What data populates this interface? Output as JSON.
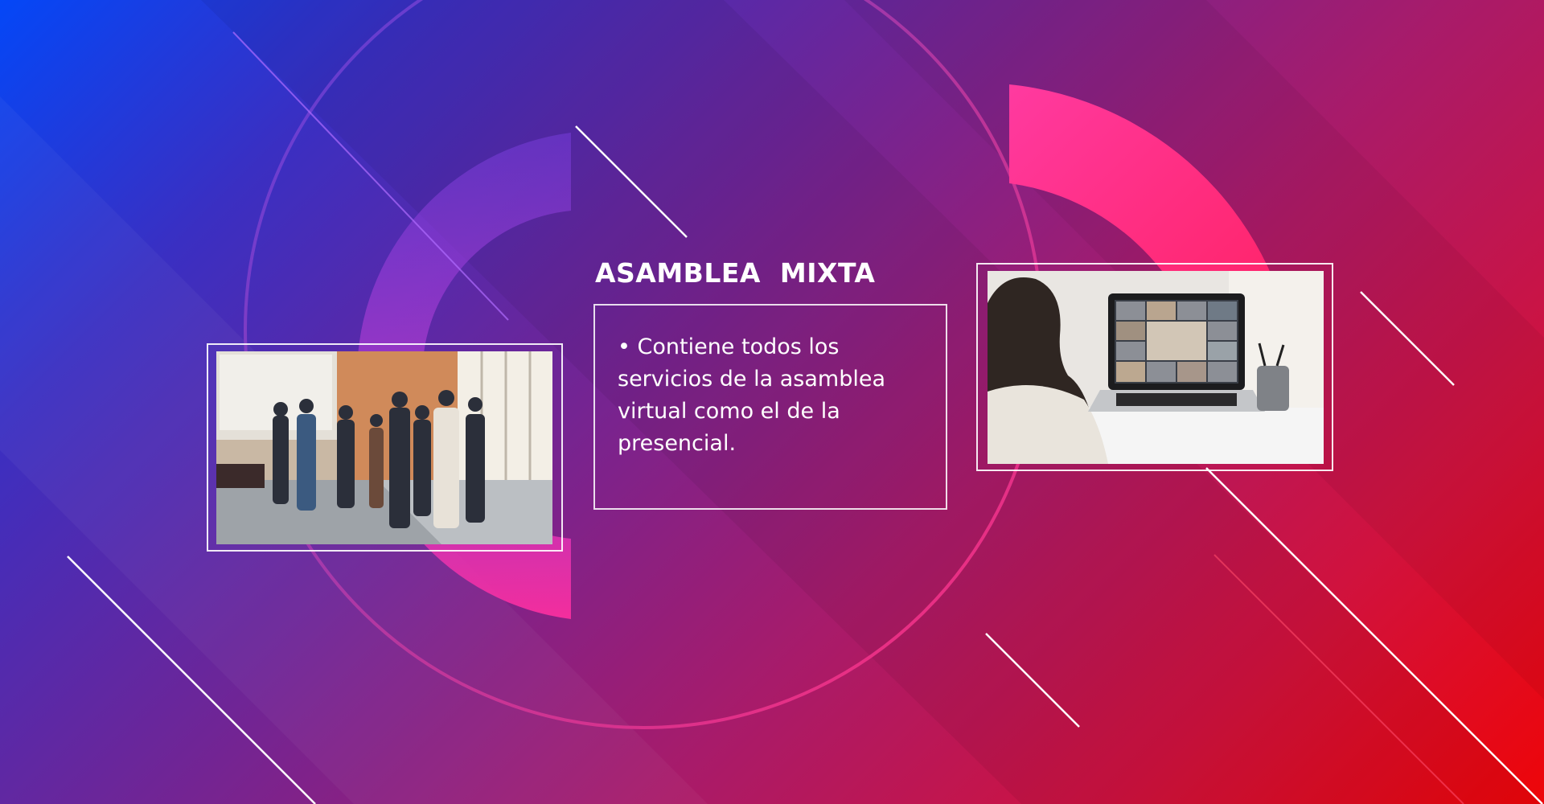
{
  "slide": {
    "title": "ASAMBLEA  MIXTA",
    "body": "• Contiene todos los servicios de la asamblea virtual como el de la presencial.",
    "images": {
      "left": "in-person-meeting-photo",
      "right": "video-conference-laptop-photo"
    }
  },
  "colors": {
    "gradient_start": "#0447f7",
    "gradient_end": "#ee0508",
    "accent_pink": "#ff2f9a",
    "text": "#ffffff"
  }
}
